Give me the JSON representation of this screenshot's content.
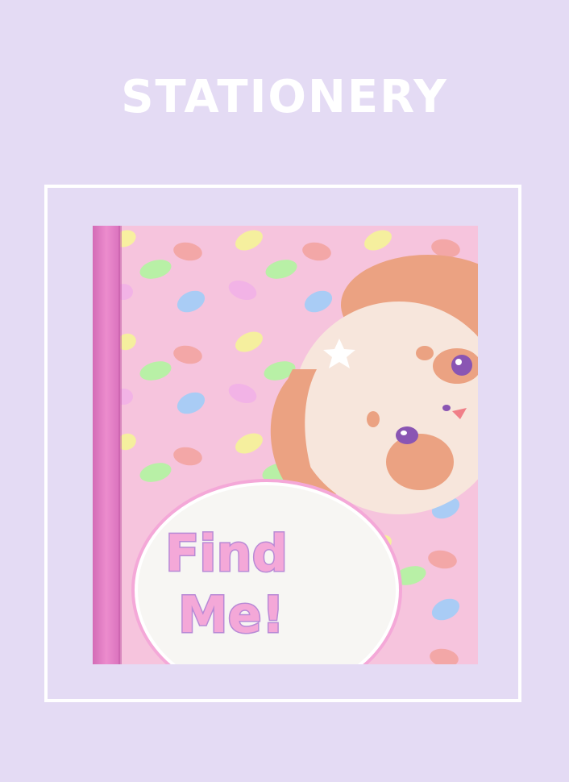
{
  "page": {
    "heading": "STATIONERY"
  },
  "product": {
    "cover_text_line1": "Find",
    "cover_text_line2": "Me!",
    "colors": {
      "background": "#e4dbf4",
      "cover_pink": "#f6c4dd",
      "spine_pink": "#e77fc6",
      "bear_orange": "#eba282",
      "bear_face": "#f7e6dc",
      "eye_purple": "#8a55b3",
      "title_pink": "#f4a8d8",
      "title_outline": "#f7d0ec"
    }
  }
}
